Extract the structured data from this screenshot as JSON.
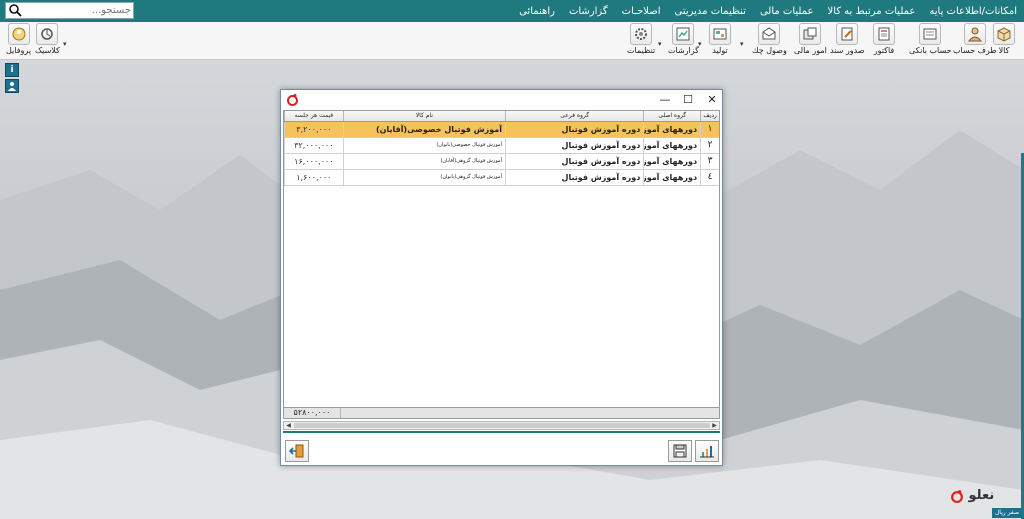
{
  "menubar": {
    "items": [
      "امکانات/اطلاعات پایه",
      "عملیات مرتبط به کالا",
      "عملیات مالی",
      "تنظیمات مدیریتی",
      "اصلاحـات",
      "گزارشات",
      "راهنمائی"
    ],
    "search_placeholder": "جستجو...",
    "search_value": "جستجو..."
  },
  "toolbar": {
    "right_buttons": [
      "کالا",
      "طرف حساب",
      "حساب بانکی",
      "فاکتور",
      "صدور سند",
      "امور مالی",
      "وصول چك",
      "تولید",
      "گزارشات",
      "تنظیمات"
    ],
    "left_buttons": [
      "پروفایل",
      "کلاسیک"
    ]
  },
  "dialog": {
    "columns": [
      "ردیف",
      "گروه اصلی",
      "گروه فرعی",
      "نام کالا",
      "قیمت هر جلسه"
    ],
    "rows": [
      {
        "idx": "۱",
        "main_group": "دورههای آموزشی",
        "sub_group": "دوره آموزش فوتبال",
        "name": "آموزش فوتبال خصوصی(آقایان)",
        "price": "۳,۲۰۰,۰۰۰"
      },
      {
        "idx": "۲",
        "main_group": "دورههای آموزشی",
        "sub_group": "دوره آموزش فوتبال",
        "name": "آموزش فوتبال خصوصی(بانوان)",
        "price": "۳۲,۰۰۰,۰۰۰"
      },
      {
        "idx": "۳",
        "main_group": "دورههای آموزشی",
        "sub_group": "دوره آموزش فوتبال",
        "name": "آموزش فوتبال گروهی(آقایان)",
        "price": "۱۶,۰۰۰,۰۰۰"
      },
      {
        "idx": "٤",
        "main_group": "دورههای آموزشی",
        "sub_group": "دوره آموزش فوتبال",
        "name": "آموزش فوتبال گروهی(بانوان)",
        "price": "۱,۶۰۰,۰۰۰"
      }
    ],
    "total": "۵۲۸۰۰,۰۰۰",
    "selected_row": 0
  },
  "brand": {
    "name": "نعلو",
    "badge": "صفر ریال"
  },
  "colors": {
    "accent": "#1f7a7f",
    "selection": "#f7c25b",
    "brand_red": "#e02020"
  }
}
